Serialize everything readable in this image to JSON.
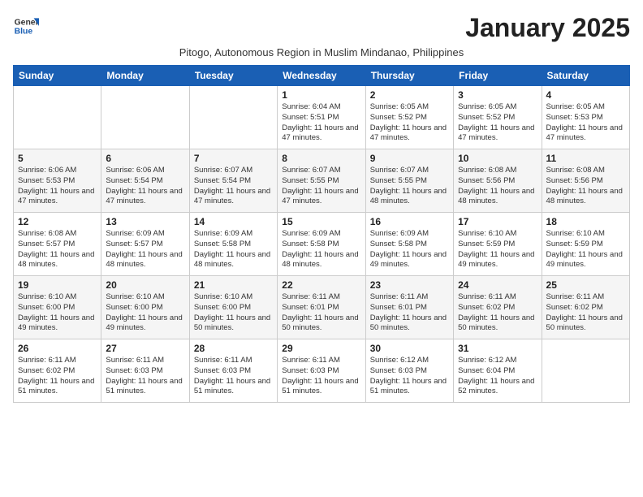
{
  "logo": {
    "line1": "General",
    "line2": "Blue"
  },
  "title": "January 2025",
  "subtitle": "Pitogo, Autonomous Region in Muslim Mindanao, Philippines",
  "days_of_week": [
    "Sunday",
    "Monday",
    "Tuesday",
    "Wednesday",
    "Thursday",
    "Friday",
    "Saturday"
  ],
  "weeks": [
    [
      {
        "day": "",
        "text": ""
      },
      {
        "day": "",
        "text": ""
      },
      {
        "day": "",
        "text": ""
      },
      {
        "day": "1",
        "text": "Sunrise: 6:04 AM\nSunset: 5:51 PM\nDaylight: 11 hours and 47 minutes."
      },
      {
        "day": "2",
        "text": "Sunrise: 6:05 AM\nSunset: 5:52 PM\nDaylight: 11 hours and 47 minutes."
      },
      {
        "day": "3",
        "text": "Sunrise: 6:05 AM\nSunset: 5:52 PM\nDaylight: 11 hours and 47 minutes."
      },
      {
        "day": "4",
        "text": "Sunrise: 6:05 AM\nSunset: 5:53 PM\nDaylight: 11 hours and 47 minutes."
      }
    ],
    [
      {
        "day": "5",
        "text": "Sunrise: 6:06 AM\nSunset: 5:53 PM\nDaylight: 11 hours and 47 minutes."
      },
      {
        "day": "6",
        "text": "Sunrise: 6:06 AM\nSunset: 5:54 PM\nDaylight: 11 hours and 47 minutes."
      },
      {
        "day": "7",
        "text": "Sunrise: 6:07 AM\nSunset: 5:54 PM\nDaylight: 11 hours and 47 minutes."
      },
      {
        "day": "8",
        "text": "Sunrise: 6:07 AM\nSunset: 5:55 PM\nDaylight: 11 hours and 47 minutes."
      },
      {
        "day": "9",
        "text": "Sunrise: 6:07 AM\nSunset: 5:55 PM\nDaylight: 11 hours and 48 minutes."
      },
      {
        "day": "10",
        "text": "Sunrise: 6:08 AM\nSunset: 5:56 PM\nDaylight: 11 hours and 48 minutes."
      },
      {
        "day": "11",
        "text": "Sunrise: 6:08 AM\nSunset: 5:56 PM\nDaylight: 11 hours and 48 minutes."
      }
    ],
    [
      {
        "day": "12",
        "text": "Sunrise: 6:08 AM\nSunset: 5:57 PM\nDaylight: 11 hours and 48 minutes."
      },
      {
        "day": "13",
        "text": "Sunrise: 6:09 AM\nSunset: 5:57 PM\nDaylight: 11 hours and 48 minutes."
      },
      {
        "day": "14",
        "text": "Sunrise: 6:09 AM\nSunset: 5:58 PM\nDaylight: 11 hours and 48 minutes."
      },
      {
        "day": "15",
        "text": "Sunrise: 6:09 AM\nSunset: 5:58 PM\nDaylight: 11 hours and 48 minutes."
      },
      {
        "day": "16",
        "text": "Sunrise: 6:09 AM\nSunset: 5:58 PM\nDaylight: 11 hours and 49 minutes."
      },
      {
        "day": "17",
        "text": "Sunrise: 6:10 AM\nSunset: 5:59 PM\nDaylight: 11 hours and 49 minutes."
      },
      {
        "day": "18",
        "text": "Sunrise: 6:10 AM\nSunset: 5:59 PM\nDaylight: 11 hours and 49 minutes."
      }
    ],
    [
      {
        "day": "19",
        "text": "Sunrise: 6:10 AM\nSunset: 6:00 PM\nDaylight: 11 hours and 49 minutes."
      },
      {
        "day": "20",
        "text": "Sunrise: 6:10 AM\nSunset: 6:00 PM\nDaylight: 11 hours and 49 minutes."
      },
      {
        "day": "21",
        "text": "Sunrise: 6:10 AM\nSunset: 6:00 PM\nDaylight: 11 hours and 50 minutes."
      },
      {
        "day": "22",
        "text": "Sunrise: 6:11 AM\nSunset: 6:01 PM\nDaylight: 11 hours and 50 minutes."
      },
      {
        "day": "23",
        "text": "Sunrise: 6:11 AM\nSunset: 6:01 PM\nDaylight: 11 hours and 50 minutes."
      },
      {
        "day": "24",
        "text": "Sunrise: 6:11 AM\nSunset: 6:02 PM\nDaylight: 11 hours and 50 minutes."
      },
      {
        "day": "25",
        "text": "Sunrise: 6:11 AM\nSunset: 6:02 PM\nDaylight: 11 hours and 50 minutes."
      }
    ],
    [
      {
        "day": "26",
        "text": "Sunrise: 6:11 AM\nSunset: 6:02 PM\nDaylight: 11 hours and 51 minutes."
      },
      {
        "day": "27",
        "text": "Sunrise: 6:11 AM\nSunset: 6:03 PM\nDaylight: 11 hours and 51 minutes."
      },
      {
        "day": "28",
        "text": "Sunrise: 6:11 AM\nSunset: 6:03 PM\nDaylight: 11 hours and 51 minutes."
      },
      {
        "day": "29",
        "text": "Sunrise: 6:11 AM\nSunset: 6:03 PM\nDaylight: 11 hours and 51 minutes."
      },
      {
        "day": "30",
        "text": "Sunrise: 6:12 AM\nSunset: 6:03 PM\nDaylight: 11 hours and 51 minutes."
      },
      {
        "day": "31",
        "text": "Sunrise: 6:12 AM\nSunset: 6:04 PM\nDaylight: 11 hours and 52 minutes."
      },
      {
        "day": "",
        "text": ""
      }
    ]
  ]
}
